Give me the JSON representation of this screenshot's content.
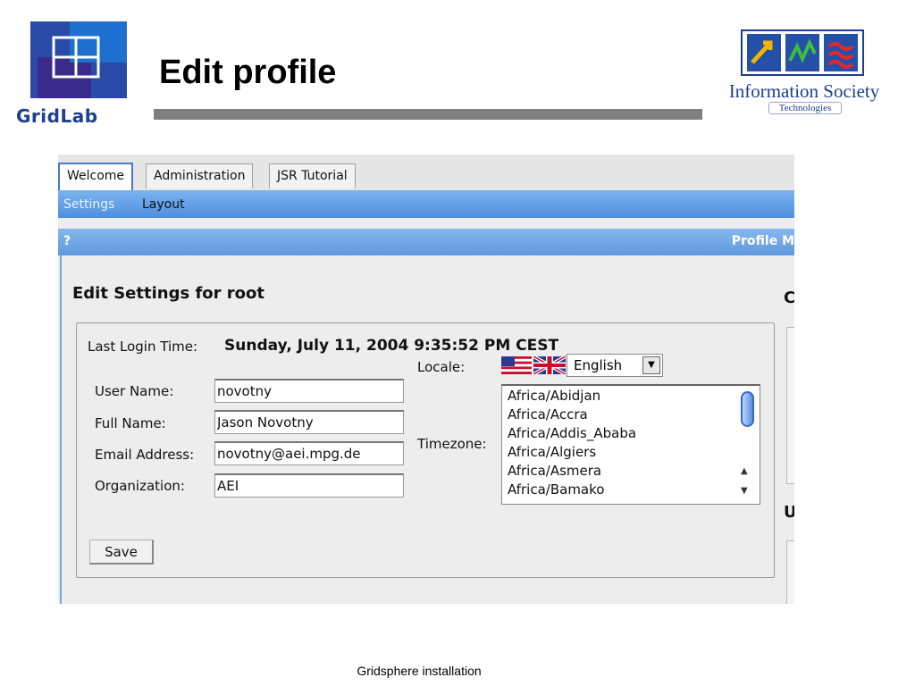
{
  "slide": {
    "title": "Edit profile",
    "footer": "Gridsphere installation",
    "logo_left_text": "GridLab",
    "logo_right_text": "Information Society",
    "logo_right_subtext": "Technologies"
  },
  "portal": {
    "tabs": [
      {
        "label": "Welcome",
        "active": true
      },
      {
        "label": "Administration",
        "active": false
      },
      {
        "label": "JSR Tutorial",
        "active": false
      }
    ],
    "subnav": [
      {
        "label": "Settings",
        "active": true
      },
      {
        "label": "Layout",
        "active": false
      }
    ],
    "titlebar": {
      "help": "?",
      "portlet_title": "Profile M"
    },
    "section_heading": "Edit Settings for  root",
    "right_headings": [
      "C",
      "U"
    ],
    "last_login": {
      "label": "Last Login Time:",
      "value": "Sunday, July 11, 2004 9:35:52 PM CEST"
    },
    "fields": [
      {
        "label": "User Name:",
        "value": "novotny"
      },
      {
        "label": "Full Name:",
        "value": "Jason Novotny"
      },
      {
        "label": "Email Address:",
        "value": "novotny@aei.mpg.de"
      },
      {
        "label": "Organization:",
        "value": "AEI"
      }
    ],
    "locale": {
      "label": "Locale:",
      "value": "English"
    },
    "timezone": {
      "label": "Timezone:",
      "options": [
        "Africa/Abidjan",
        "Africa/Accra",
        "Africa/Addis_Ababa",
        "Africa/Algiers",
        "Africa/Asmera",
        "Africa/Bamako"
      ]
    },
    "save_label": "Save"
  },
  "colors": {
    "tab_accent": "#4a78c8",
    "nav_blue": "#5e98de",
    "gridlab_blue": "#1d3f8f",
    "title_rule": "#7f7f7f"
  }
}
